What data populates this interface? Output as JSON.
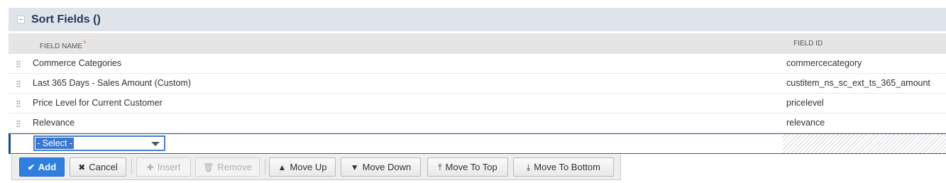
{
  "section": {
    "title": "Sort Fields ()"
  },
  "columns": {
    "field_name": "FIELD NAME",
    "required_mark": "*",
    "field_id": "FIELD ID"
  },
  "rows": [
    {
      "field_name": "Commerce Categories",
      "field_id": "commercecategory"
    },
    {
      "field_name": "Last 365 Days - Sales Amount (Custom)",
      "field_id": "custitem_ns_sc_ext_ts_365_amount"
    },
    {
      "field_name": "Price Level for Current Customer",
      "field_id": "pricelevel"
    },
    {
      "field_name": "Relevance",
      "field_id": "relevance"
    }
  ],
  "edit_row": {
    "select_value": "- Select -"
  },
  "toolbar": {
    "add": "Add",
    "cancel": "Cancel",
    "insert": "Insert",
    "remove": "Remove",
    "move_up": "Move Up",
    "move_down": "Move Down",
    "move_to_top": "Move To Top",
    "move_to_bottom": "Move To Bottom"
  },
  "icons": {
    "add": "check-icon",
    "cancel": "x-icon",
    "insert": "plus-icon",
    "remove": "trash-icon",
    "move_up": "arrow-up-icon",
    "move_down": "arrow-down-icon",
    "move_to_top": "arrow-to-top-icon",
    "move_to_bottom": "arrow-to-bottom-icon"
  },
  "colors": {
    "primary": "#2f7fe0",
    "header_bg": "#dfe4eb",
    "title": "#24385b",
    "required": "#e88a2f"
  }
}
